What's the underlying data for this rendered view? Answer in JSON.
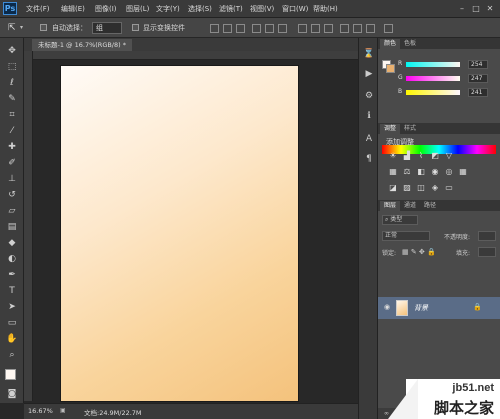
{
  "app": {
    "logo": "Ps"
  },
  "menubar": {
    "items": [
      "文件(F)",
      "编辑(E)",
      "图像(I)",
      "图层(L)",
      "文字(Y)",
      "选择(S)",
      "滤镜(T)",
      "视图(V)",
      "窗口(W)",
      "帮助(H)"
    ]
  },
  "options": {
    "auto_select_label": "自动选择：",
    "auto_select_value": "组",
    "show_transform_label": "显示变换控件"
  },
  "document": {
    "tab_title": "未标题-1 @ 16.7%(RGB/8) *",
    "zoom": "16.67%",
    "doc_info": "文档:24.9M/22.7M"
  },
  "color_panel": {
    "tabs": [
      "颜色",
      "色板"
    ],
    "channels": [
      {
        "label": "R",
        "value": "254"
      },
      {
        "label": "G",
        "value": "247"
      },
      {
        "label": "B",
        "value": "241"
      }
    ]
  },
  "adjust_panel": {
    "tabs": [
      "调整",
      "样式"
    ],
    "title": "添加调整"
  },
  "layers_panel": {
    "tabs": [
      "图层",
      "通道",
      "路径"
    ],
    "filter_kind": "类型",
    "blend_mode": "正常",
    "opacity_label": "不透明度:",
    "lock_label": "锁定:",
    "fill_label": "填充:",
    "layer_name": "背景"
  },
  "watermark": {
    "site": "jb51.net",
    "text": "脚本之家"
  },
  "colors": {
    "canvas_top": "#fffbf7",
    "canvas_bottom": "#f4c27c",
    "selection": "#5a6c87"
  }
}
